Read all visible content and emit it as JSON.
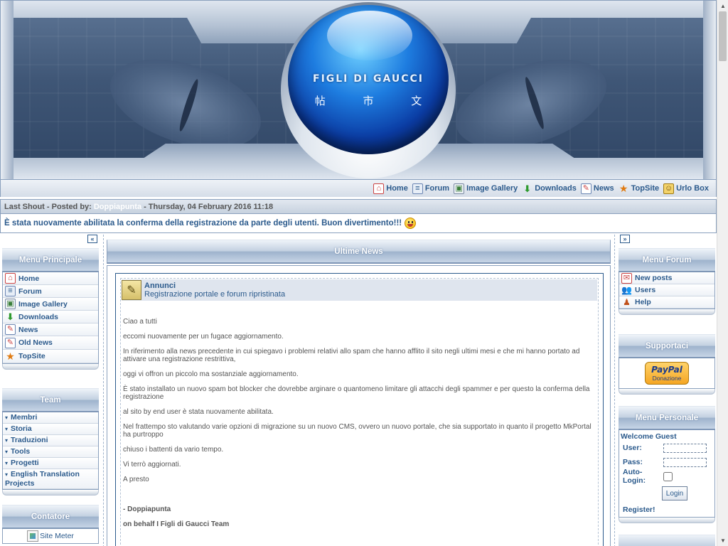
{
  "banner": {
    "logo_text": "FIGLI DI GAUCCI",
    "logo_kanji": "帖 市 文"
  },
  "topnav": {
    "items": [
      {
        "label": "Home",
        "icon": "home-icon"
      },
      {
        "label": "Forum",
        "icon": "forum-icon"
      },
      {
        "label": "Image Gallery",
        "icon": "gallery-icon"
      },
      {
        "label": "Downloads",
        "icon": "downloads-icon"
      },
      {
        "label": "News",
        "icon": "news-icon"
      },
      {
        "label": "TopSite",
        "icon": "topsite-icon"
      },
      {
        "label": "Urlo Box",
        "icon": "urlobox-icon"
      }
    ]
  },
  "shout": {
    "prefix": "Last Shout - Posted by:",
    "poster": "Doppiapunta",
    "date": "- Thursday, 04 February 2016 11:18",
    "message": "È stata nuovamente abilitata la conferma della registrazione da parte degli utenti. Buon divertimento!!!"
  },
  "left": {
    "collapse_label": "«",
    "menu_principale": {
      "title": "Menu Principale",
      "items": [
        "Home",
        "Forum",
        "Image Gallery",
        "Downloads",
        "News",
        "Old News",
        "TopSite"
      ]
    },
    "team": {
      "title": "Team",
      "items": [
        "Membri",
        "Storia",
        "Traduzioni",
        "Tools",
        "Progetti",
        "English Translation Projects"
      ]
    },
    "contatore": {
      "title": "Contatore",
      "site_meter_alt": "Site Meter"
    }
  },
  "center": {
    "title": "Ultime News",
    "news": {
      "category": "Annunci",
      "headline": "Registrazione portale e forum ripristinata",
      "paragraphs": [
        "Ciao a tutti",
        "eccomi nuovamente per un fugace aggiornamento.",
        "In riferimento alla news precedente in cui spiegavo i problemi relativi allo spam che hanno afflito il sito negli ultimi mesi e che mi hanno portato ad attivare una registrazione restrittiva,",
        "oggi vi offron un piccolo ma sostanziale aggiornamento.",
        "È stato installato un nuovo spam bot blocker che dovrebbe arginare o quantomeno limitare gli attacchi degli spammer e per questo la conferma della registrazione",
        "al sito by end user è stata nuovamente abilitata.",
        "Nel frattempo sto valutando varie opzioni di migrazione su un nuovo CMS, ovvero un nuovo portale, che sia supportato in quanto il progetto MkPortal ha purtroppo",
        "chiuso i battenti da vario tempo.",
        "Vi terrò aggiornati.",
        "A presto"
      ],
      "signature": "- Doppiapunta",
      "signature2": "on behalf I Figli di Gaucci Team"
    }
  },
  "right": {
    "collapse_label": "»",
    "menu_forum": {
      "title": "Menu Forum",
      "items": [
        "New posts",
        "Users",
        "Help"
      ]
    },
    "supportaci": {
      "title": "Supportaci",
      "paypal_brand": "PayPal",
      "paypal_label": "Donazione"
    },
    "menu_personale": {
      "title": "Menu Personale",
      "welcome": "Welcome Guest",
      "user_label": "User:",
      "pass_label": "Pass:",
      "autologin_label": "Auto-Login:",
      "login_button": "Login",
      "register_link": "Register!"
    }
  }
}
